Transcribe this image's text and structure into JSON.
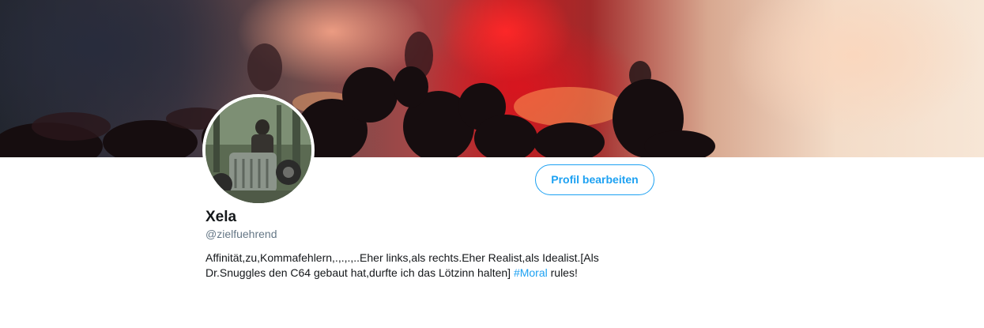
{
  "profile": {
    "name": "Xela",
    "handle": "@zielfuehrend",
    "bio_part1": "Affinität,zu,Kommafehlern,.,.,.,..Eher links,als rechts.Eher Realist,als Idealist.[Als Dr.Snuggles den C64 gebaut hat,durfte ich das Lötzinn halten]",
    "bio_hashtag": "#Moral",
    "bio_part2": "rules!"
  },
  "actions": {
    "edit_profile_label": "Profil bearbeiten"
  },
  "colors": {
    "accent": "#1da1f2",
    "name_text": "#14171a",
    "muted_text": "#657786"
  }
}
